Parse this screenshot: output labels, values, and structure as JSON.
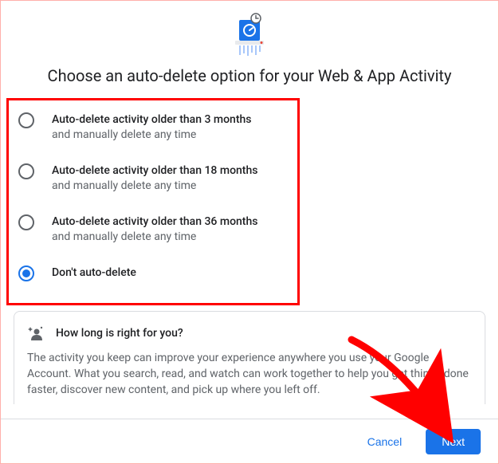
{
  "heading": "Choose an auto-delete option for your Web & App Activity",
  "options": [
    {
      "primary": "Auto-delete activity older than 3 months",
      "secondary": "and manually delete any time",
      "selected": false
    },
    {
      "primary": "Auto-delete activity older than 18 months",
      "secondary": "and manually delete any time",
      "selected": false
    },
    {
      "primary": "Auto-delete activity older than 36 months",
      "secondary": "and manually delete any time",
      "selected": false
    },
    {
      "primary": "Don't auto-delete",
      "secondary": "",
      "selected": true
    }
  ],
  "info": {
    "title": "How long is right for you?",
    "body": "The activity you keep can improve your experience anywhere you use your Google Account. What you search, read, and watch can work together to help you get things done faster, discover new content, and pick up where you left off."
  },
  "footer": {
    "cancel": "Cancel",
    "next": "Next"
  },
  "colors": {
    "accent": "#1a73e8",
    "annotation": "#ff0000"
  }
}
